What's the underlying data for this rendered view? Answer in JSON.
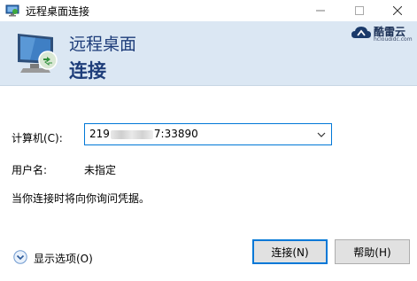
{
  "window": {
    "title": "远程桌面连接",
    "controls": {
      "minimize": "—",
      "maximize": "☐",
      "close": "✕"
    }
  },
  "banner": {
    "line1": "远程桌面",
    "line2": "连接",
    "brand_name": "酷雷云",
    "brand_url": "hcloudidc.com"
  },
  "form": {
    "computer_label": "计算机(C):",
    "computer_value_start": "219",
    "computer_value_end": "7:33890",
    "user_label": "用户名:",
    "user_value": "未指定",
    "hint": "当你连接时将向你询问凭据。"
  },
  "footer": {
    "options_label": "显示选项(O)",
    "connect_label": "连接(N)",
    "help_label": "帮助(H)"
  },
  "colors": {
    "accent": "#0078d7",
    "banner_bg": "#dbe7f3",
    "banner_text": "#1e3d7a"
  },
  "icons": {
    "app": "remote-desktop-icon",
    "banner": "remote-desktop-monitor-icon",
    "brand": "cloud-logo-icon",
    "combo": "chevron-down-icon",
    "options": "expand-circle-icon"
  }
}
